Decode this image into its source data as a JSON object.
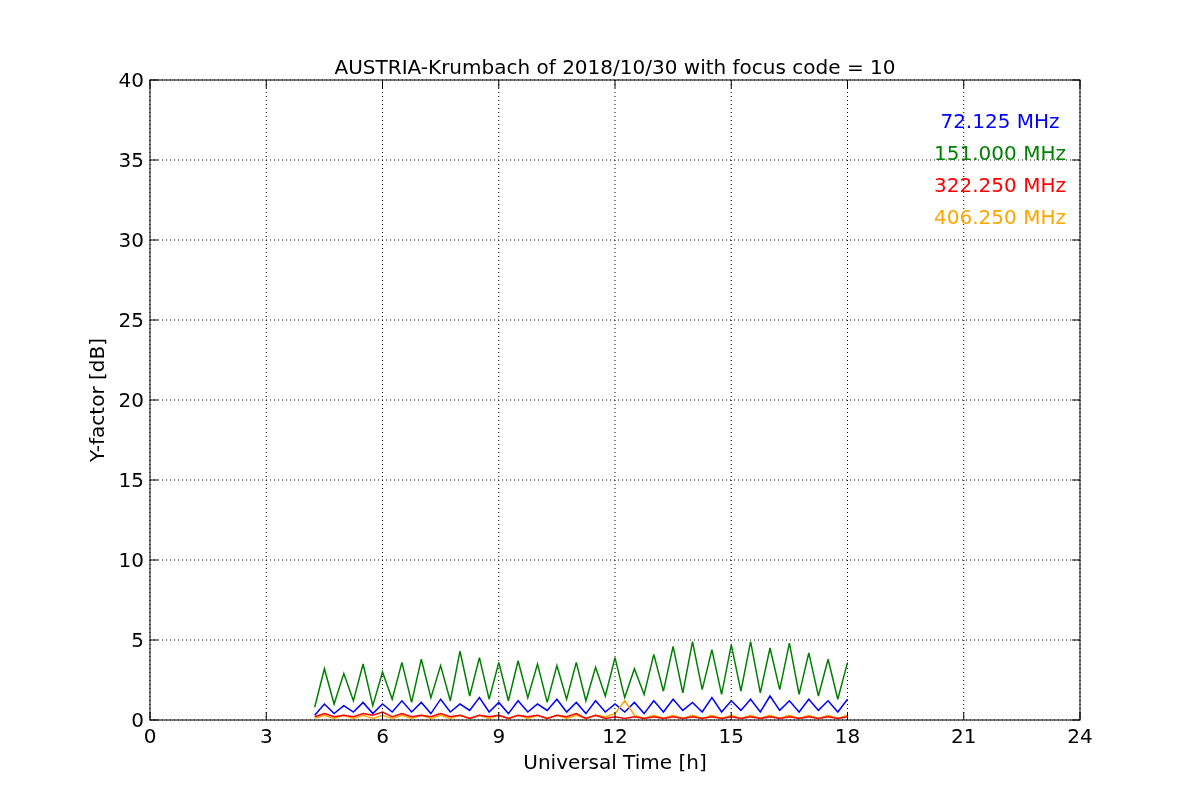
{
  "chart_data": {
    "type": "line",
    "title": "AUSTRIA-Krumbach of 2018/10/30 with focus code = 10",
    "xlabel": "Universal Time [h]",
    "ylabel": "Y-factor [dB]",
    "xlim": [
      0,
      24
    ],
    "ylim": [
      0,
      40
    ],
    "xticks": [
      0,
      3,
      6,
      9,
      12,
      15,
      18,
      21,
      24
    ],
    "yticks": [
      0,
      5,
      10,
      15,
      20,
      25,
      30,
      35,
      40
    ],
    "grid": true,
    "x": [
      4.25,
      4.5,
      4.75,
      5,
      5.25,
      5.5,
      5.75,
      6,
      6.25,
      6.5,
      6.75,
      7,
      7.25,
      7.5,
      7.75,
      8,
      8.25,
      8.5,
      8.75,
      9,
      9.25,
      9.5,
      9.75,
      10,
      10.25,
      10.5,
      10.75,
      11,
      11.25,
      11.5,
      11.75,
      12,
      12.25,
      12.5,
      12.75,
      13,
      13.25,
      13.5,
      13.75,
      14,
      14.25,
      14.5,
      14.75,
      15,
      15.25,
      15.5,
      15.75,
      16,
      16.25,
      16.5,
      16.75,
      17,
      17.25,
      17.5,
      17.75,
      18
    ],
    "series": [
      {
        "name": "72.125 MHz",
        "color": "#0000ff",
        "values": [
          0.3,
          1.0,
          0.4,
          0.9,
          0.5,
          1.1,
          0.4,
          1.0,
          0.5,
          1.2,
          0.5,
          1.1,
          0.4,
          1.3,
          0.5,
          1.0,
          0.6,
          1.4,
          0.5,
          1.1,
          0.4,
          1.2,
          0.5,
          1.0,
          0.6,
          1.3,
          0.5,
          1.1,
          0.4,
          1.2,
          0.5,
          1.0,
          0.5,
          1.1,
          0.4,
          1.2,
          0.5,
          1.3,
          0.6,
          1.1,
          0.5,
          1.4,
          0.5,
          1.2,
          0.6,
          1.3,
          0.5,
          1.5,
          0.6,
          1.2,
          0.5,
          1.3,
          0.6,
          1.2,
          0.5,
          1.3
        ]
      },
      {
        "name": "151.000 MHz",
        "color": "#008000",
        "values": [
          0.8,
          3.2,
          1.0,
          2.9,
          1.2,
          3.5,
          0.9,
          3.0,
          1.3,
          3.6,
          1.1,
          3.8,
          1.4,
          3.4,
          1.2,
          4.3,
          1.5,
          3.9,
          1.3,
          3.6,
          1.2,
          3.7,
          1.4,
          3.5,
          1.1,
          3.4,
          1.3,
          3.6,
          1.2,
          3.3,
          1.5,
          3.9,
          1.4,
          3.2,
          1.6,
          4.1,
          1.8,
          4.6,
          1.7,
          4.9,
          1.9,
          4.4,
          1.6,
          4.7,
          1.8,
          4.9,
          1.7,
          4.5,
          1.9,
          4.8,
          1.6,
          4.2,
          1.5,
          3.8,
          1.3,
          3.6
        ]
      },
      {
        "name": "322.250 MHz",
        "color": "#ff0000",
        "values": [
          0.2,
          0.4,
          0.2,
          0.3,
          0.2,
          0.4,
          0.3,
          0.5,
          0.2,
          0.4,
          0.2,
          0.3,
          0.2,
          0.4,
          0.2,
          0.3,
          0.1,
          0.3,
          0.2,
          0.3,
          0.1,
          0.3,
          0.2,
          0.3,
          0.1,
          0.3,
          0.2,
          0.4,
          0.1,
          0.3,
          0.1,
          0.2,
          0.1,
          0.2,
          0.1,
          0.2,
          0.1,
          0.2,
          0.1,
          0.2,
          0.1,
          0.2,
          0.1,
          0.2,
          0.1,
          0.2,
          0.1,
          0.2,
          0.1,
          0.2,
          0.1,
          0.2,
          0.1,
          0.2,
          0.1,
          0.2
        ]
      },
      {
        "name": "406.250 MHz",
        "color": "#ffa500",
        "values": [
          0.1,
          0.3,
          0.1,
          0.3,
          0.1,
          0.3,
          0.1,
          0.3,
          0.1,
          0.3,
          0.1,
          0.3,
          0.1,
          0.3,
          0.1,
          0.3,
          0.1,
          0.3,
          0.1,
          0.3,
          0.1,
          0.3,
          0.1,
          0.3,
          0.1,
          0.3,
          0.1,
          0.3,
          0.1,
          0.3,
          0.2,
          0.4,
          1.2,
          0.3,
          0.1,
          0.3,
          0.1,
          0.3,
          0.1,
          0.3,
          0.1,
          0.3,
          0.1,
          0.3,
          0.1,
          0.3,
          0.1,
          0.3,
          0.1,
          0.3,
          0.1,
          0.3,
          0.1,
          0.3,
          0.1,
          0.3
        ]
      }
    ]
  }
}
